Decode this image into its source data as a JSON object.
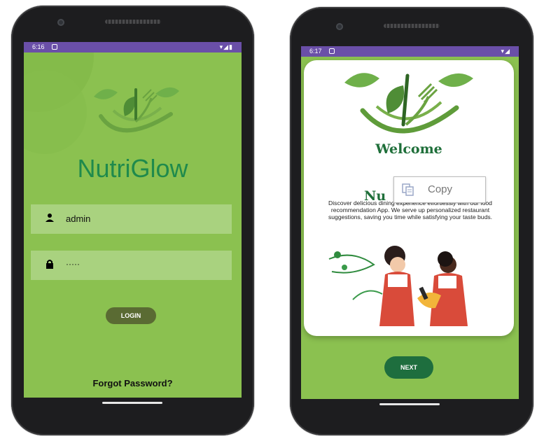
{
  "colors": {
    "screen_bg": "#8bc150",
    "status_bar": "#6a4fa8",
    "title_green": "#1f8a4c",
    "field_bg": "#a9d27f",
    "login_button": "#5a6b33",
    "next_button": "#1e6e3e"
  },
  "login_screen": {
    "status_time": "6:16",
    "status_icons": "▾◢▮",
    "app_title": "NutriGlow",
    "username": {
      "icon": "person-icon",
      "value": "admin"
    },
    "password": {
      "icon": "lock-icon",
      "value": "·····"
    },
    "login_label": "LOGIN",
    "forgot_label": "Forgot Password?"
  },
  "welcome_screen": {
    "status_time": "6:17",
    "status_icons": "▾◢",
    "welcome_title": "Welcome",
    "partial_title": "Nu",
    "description": "Discover delicious dining experience effortlessly with our food recommendation App. We serve up personalized restaurant suggestions, saving you time while satisfying your taste buds.",
    "copy_label": "Copy",
    "next_label": "NEXT"
  }
}
